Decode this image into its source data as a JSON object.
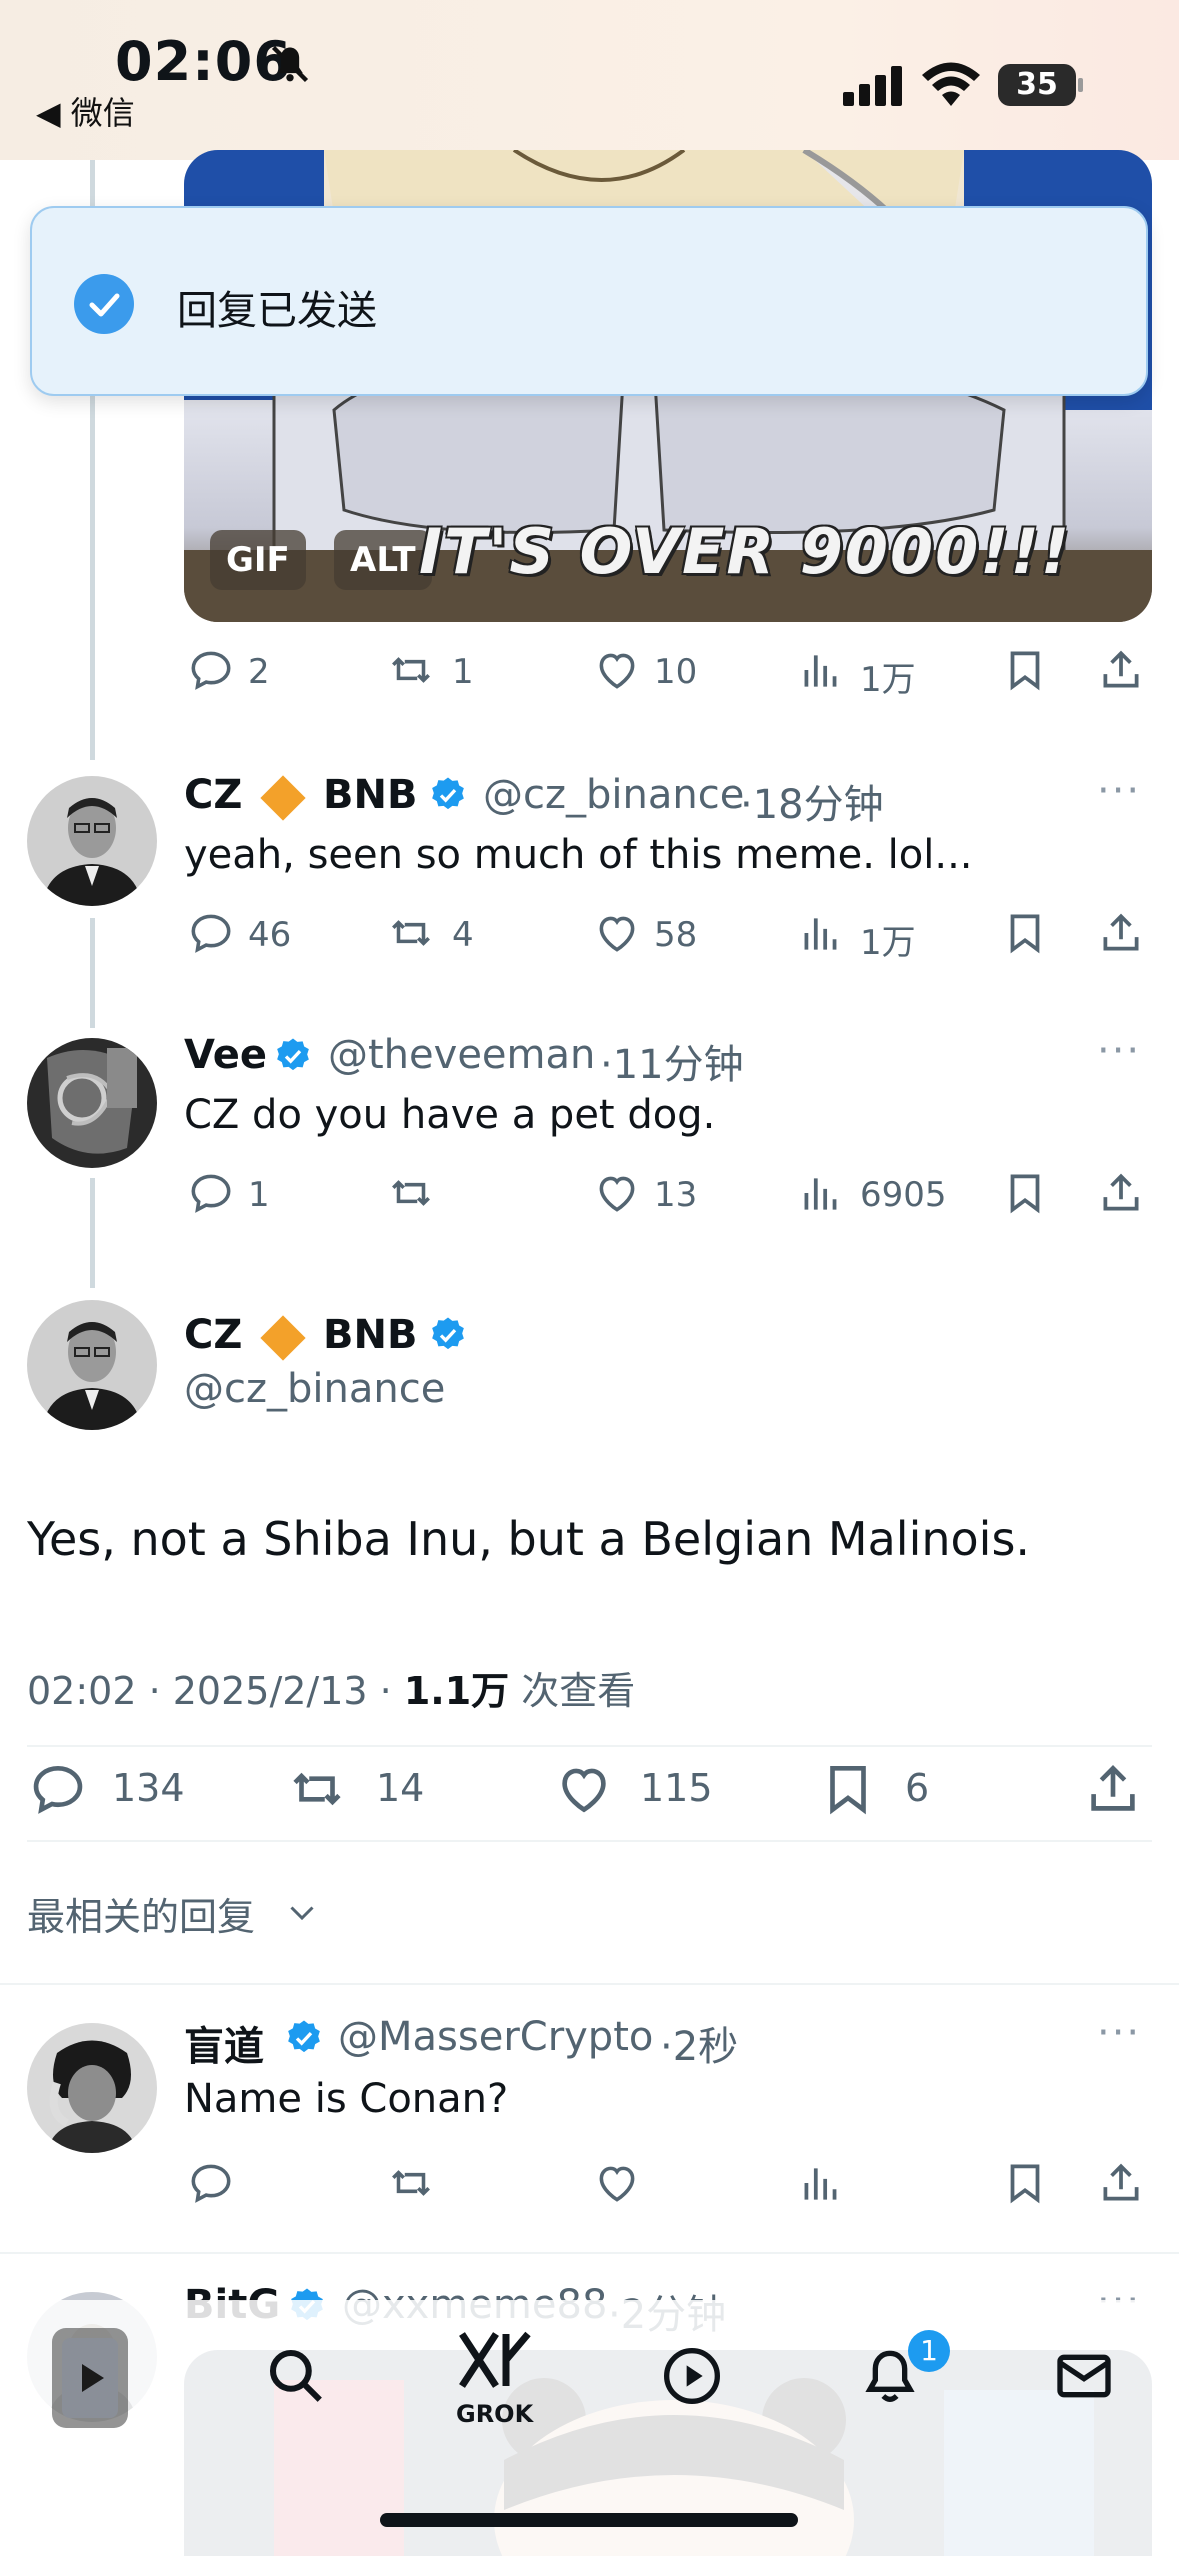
{
  "status_bar": {
    "time": "02:06",
    "back_label": "◀ 微信",
    "battery": "35"
  },
  "toast": {
    "text": "回复已发送"
  },
  "media": {
    "gif_label": "GIF",
    "alt_label": "ALT",
    "caption": "IT'S OVER 9000!!!"
  },
  "top_actions": {
    "replies": "2",
    "reposts": "1",
    "likes": "10",
    "views": "1万"
  },
  "tweets": [
    {
      "name": "CZ",
      "name_suffix": "BNB",
      "handle": "@cz_binance",
      "time": "·18分钟",
      "text": "yeah, seen so much of this meme. lol...",
      "replies": "46",
      "reposts": "4",
      "likes": "58",
      "views": "1万"
    },
    {
      "name": "Vee",
      "handle": "@theveeman",
      "time": "·11分钟",
      "text": "CZ do you have a pet dog.",
      "replies": "1",
      "reposts": "",
      "likes": "13",
      "views": "6905"
    }
  ],
  "main_tweet": {
    "name": "CZ",
    "name_suffix": "BNB",
    "handle": "@cz_binance",
    "text": "Yes, not a Shiba Inu, but a Belgian Malinois.",
    "meta_time": "02:02 · 2025/2/13 · ",
    "meta_views": "1.1万",
    "meta_views_label": " 次查看",
    "replies": "134",
    "reposts": "14",
    "likes": "115",
    "bookmarks": "6"
  },
  "sort": {
    "label": "最相关的回复"
  },
  "replies": [
    {
      "name": "盲道",
      "handle": "@MasserCrypto",
      "time": "·2秒",
      "text": "Name is Conan?"
    },
    {
      "name": "BitG",
      "handle": "@xxmeme88",
      "time": "·2分钟"
    }
  ],
  "nav": {
    "grok_label": "GROK",
    "notification_count": "1"
  },
  "colors": {
    "accent": "#1d9bf0",
    "verified": "#1d9bf0",
    "bnb": "#f3a12a",
    "secondary_text": "#536471"
  }
}
